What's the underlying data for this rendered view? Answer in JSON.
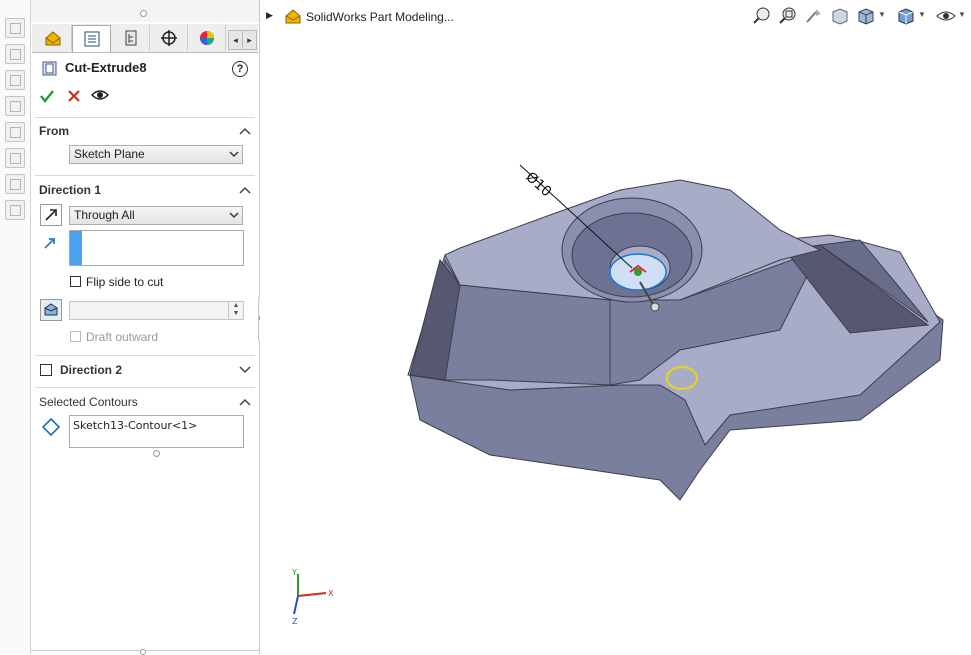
{
  "feature_manager": {
    "feature_title": "Cut-Extrude8",
    "help_symbol": "?",
    "tabs": [
      {
        "name": "featuremanager-tree",
        "icon": "part-tree-icon"
      },
      {
        "name": "propertymanager",
        "icon": "property-manager-icon"
      },
      {
        "name": "configurationmanager",
        "icon": "configuration-icon"
      },
      {
        "name": "dimxpertmanager",
        "icon": "crosshair-icon"
      },
      {
        "name": "displaymanager",
        "icon": "display-manager-icon"
      }
    ],
    "from": {
      "header": "From",
      "value": "Sketch Plane"
    },
    "direction1": {
      "header": "Direction 1",
      "end_condition": "Through All",
      "flip_side_label": "Flip side to cut",
      "draft_outward_label": "Draft outward"
    },
    "direction2": {
      "header": "Direction 2"
    },
    "selected_contours": {
      "header": "Selected Contours",
      "items": [
        "Sketch13-Contour<1>"
      ]
    }
  },
  "viewport": {
    "breadcrumb": "SolidWorks Part Modeling...",
    "dimension_label": "Ø10",
    "triad": {
      "y": "Y",
      "x": "X",
      "z": "Z"
    }
  },
  "colors": {
    "accept": "#2e9c2e",
    "cancel": "#d12b1e",
    "direction_swatch": "#4aa3f0",
    "model_face": "#a9acc7",
    "model_side": "#7b7f9e",
    "model_dark": "#555870"
  }
}
